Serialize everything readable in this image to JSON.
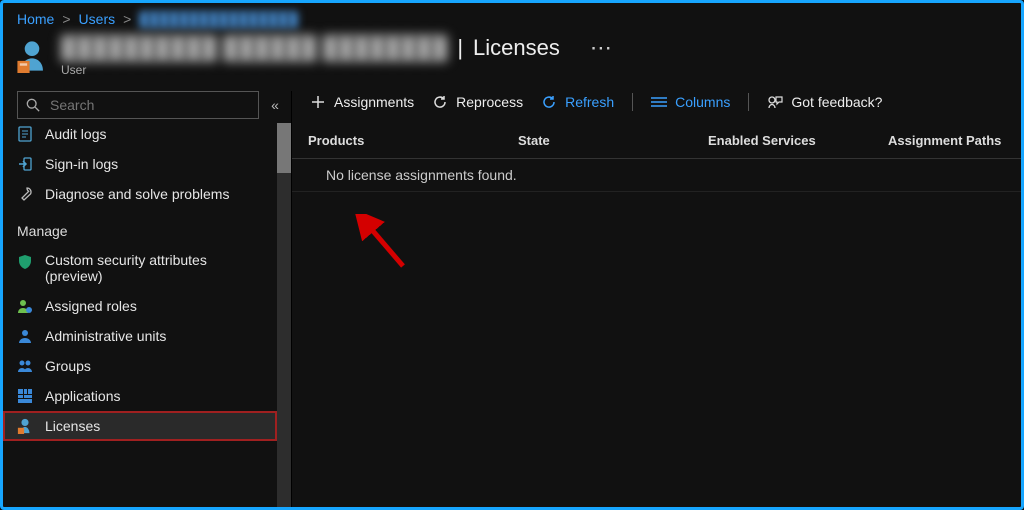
{
  "breadcrumb": {
    "home": "Home",
    "users": "Users"
  },
  "header": {
    "section": "Licenses",
    "subtitle": "User"
  },
  "sidebar": {
    "search_placeholder": "Search",
    "section_manage": "Manage",
    "items": {
      "audit_logs": "Audit logs",
      "sign_in_logs": "Sign-in logs",
      "diagnose": "Diagnose and solve problems",
      "custom_security": "Custom security attributes (preview)",
      "assigned_roles": "Assigned roles",
      "admin_units": "Administrative units",
      "groups": "Groups",
      "applications": "Applications",
      "licenses": "Licenses"
    }
  },
  "toolbar": {
    "assignments": "Assignments",
    "reprocess": "Reprocess",
    "refresh": "Refresh",
    "columns": "Columns",
    "feedback": "Got feedback?"
  },
  "table": {
    "col_products": "Products",
    "col_state": "State",
    "col_enabled_services": "Enabled Services",
    "col_assignment_paths": "Assignment Paths",
    "empty_message": "No license assignments found."
  },
  "colors": {
    "accent_blue": "#3aa0ff",
    "border_highlight": "#17a6ff",
    "annotation_red": "#d40000"
  }
}
